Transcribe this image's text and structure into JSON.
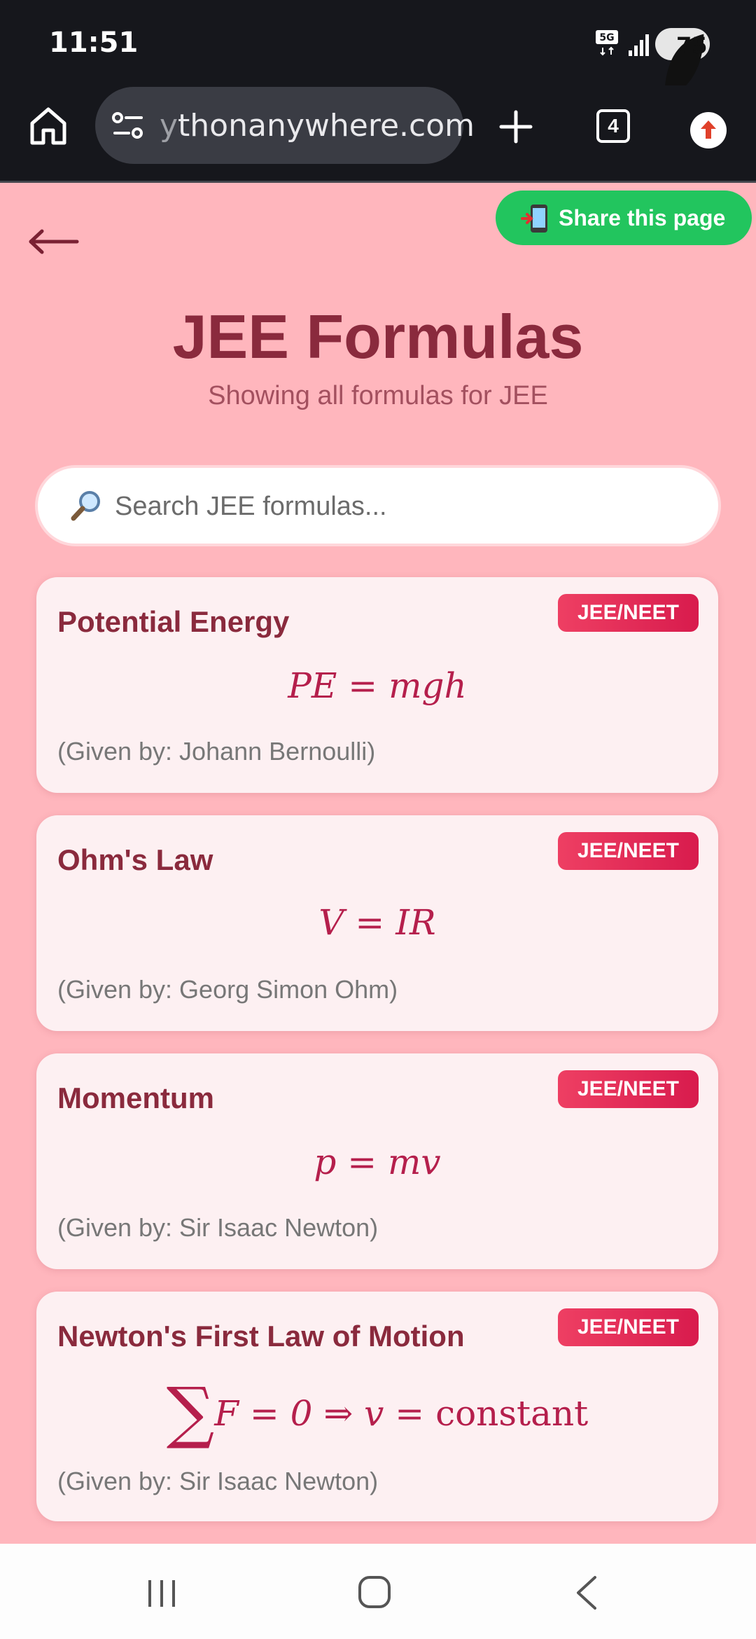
{
  "status_bar": {
    "time": "11:51",
    "battery": "75"
  },
  "browser": {
    "url_fade": "y",
    "url_rest": "thonanywhere.com",
    "tab_count": "4"
  },
  "page": {
    "share_label": "Share this page",
    "title": "JEE Formulas",
    "subtitle": "Showing all formulas for JEE",
    "search_placeholder": "Search JEE formulas..."
  },
  "cards": [
    {
      "title": "Potential Energy",
      "badge": "JEE/NEET",
      "formula": "PE = mgh",
      "source": "(Given by: Johann Bernoulli)"
    },
    {
      "title": "Ohm's Law",
      "badge": "JEE/NEET",
      "formula": "V = IR",
      "source": "(Given by: Georg Simon Ohm)"
    },
    {
      "title": "Momentum",
      "badge": "JEE/NEET",
      "formula": "p = mv",
      "source": "(Given by: Sir Isaac Newton)"
    },
    {
      "title": "Newton's First Law of Motion",
      "badge": "JEE/NEET",
      "formula_sigma": "∑",
      "formula_lhs": "F = 0 ⇒ v = ",
      "formula_const": "constant",
      "source": "(Given by: Sir Isaac Newton)"
    }
  ],
  "colors": {
    "page_bg": "#ffb6bd",
    "accent": "#8a2a3d",
    "badge": "#e8305a",
    "share": "#22c55e"
  }
}
